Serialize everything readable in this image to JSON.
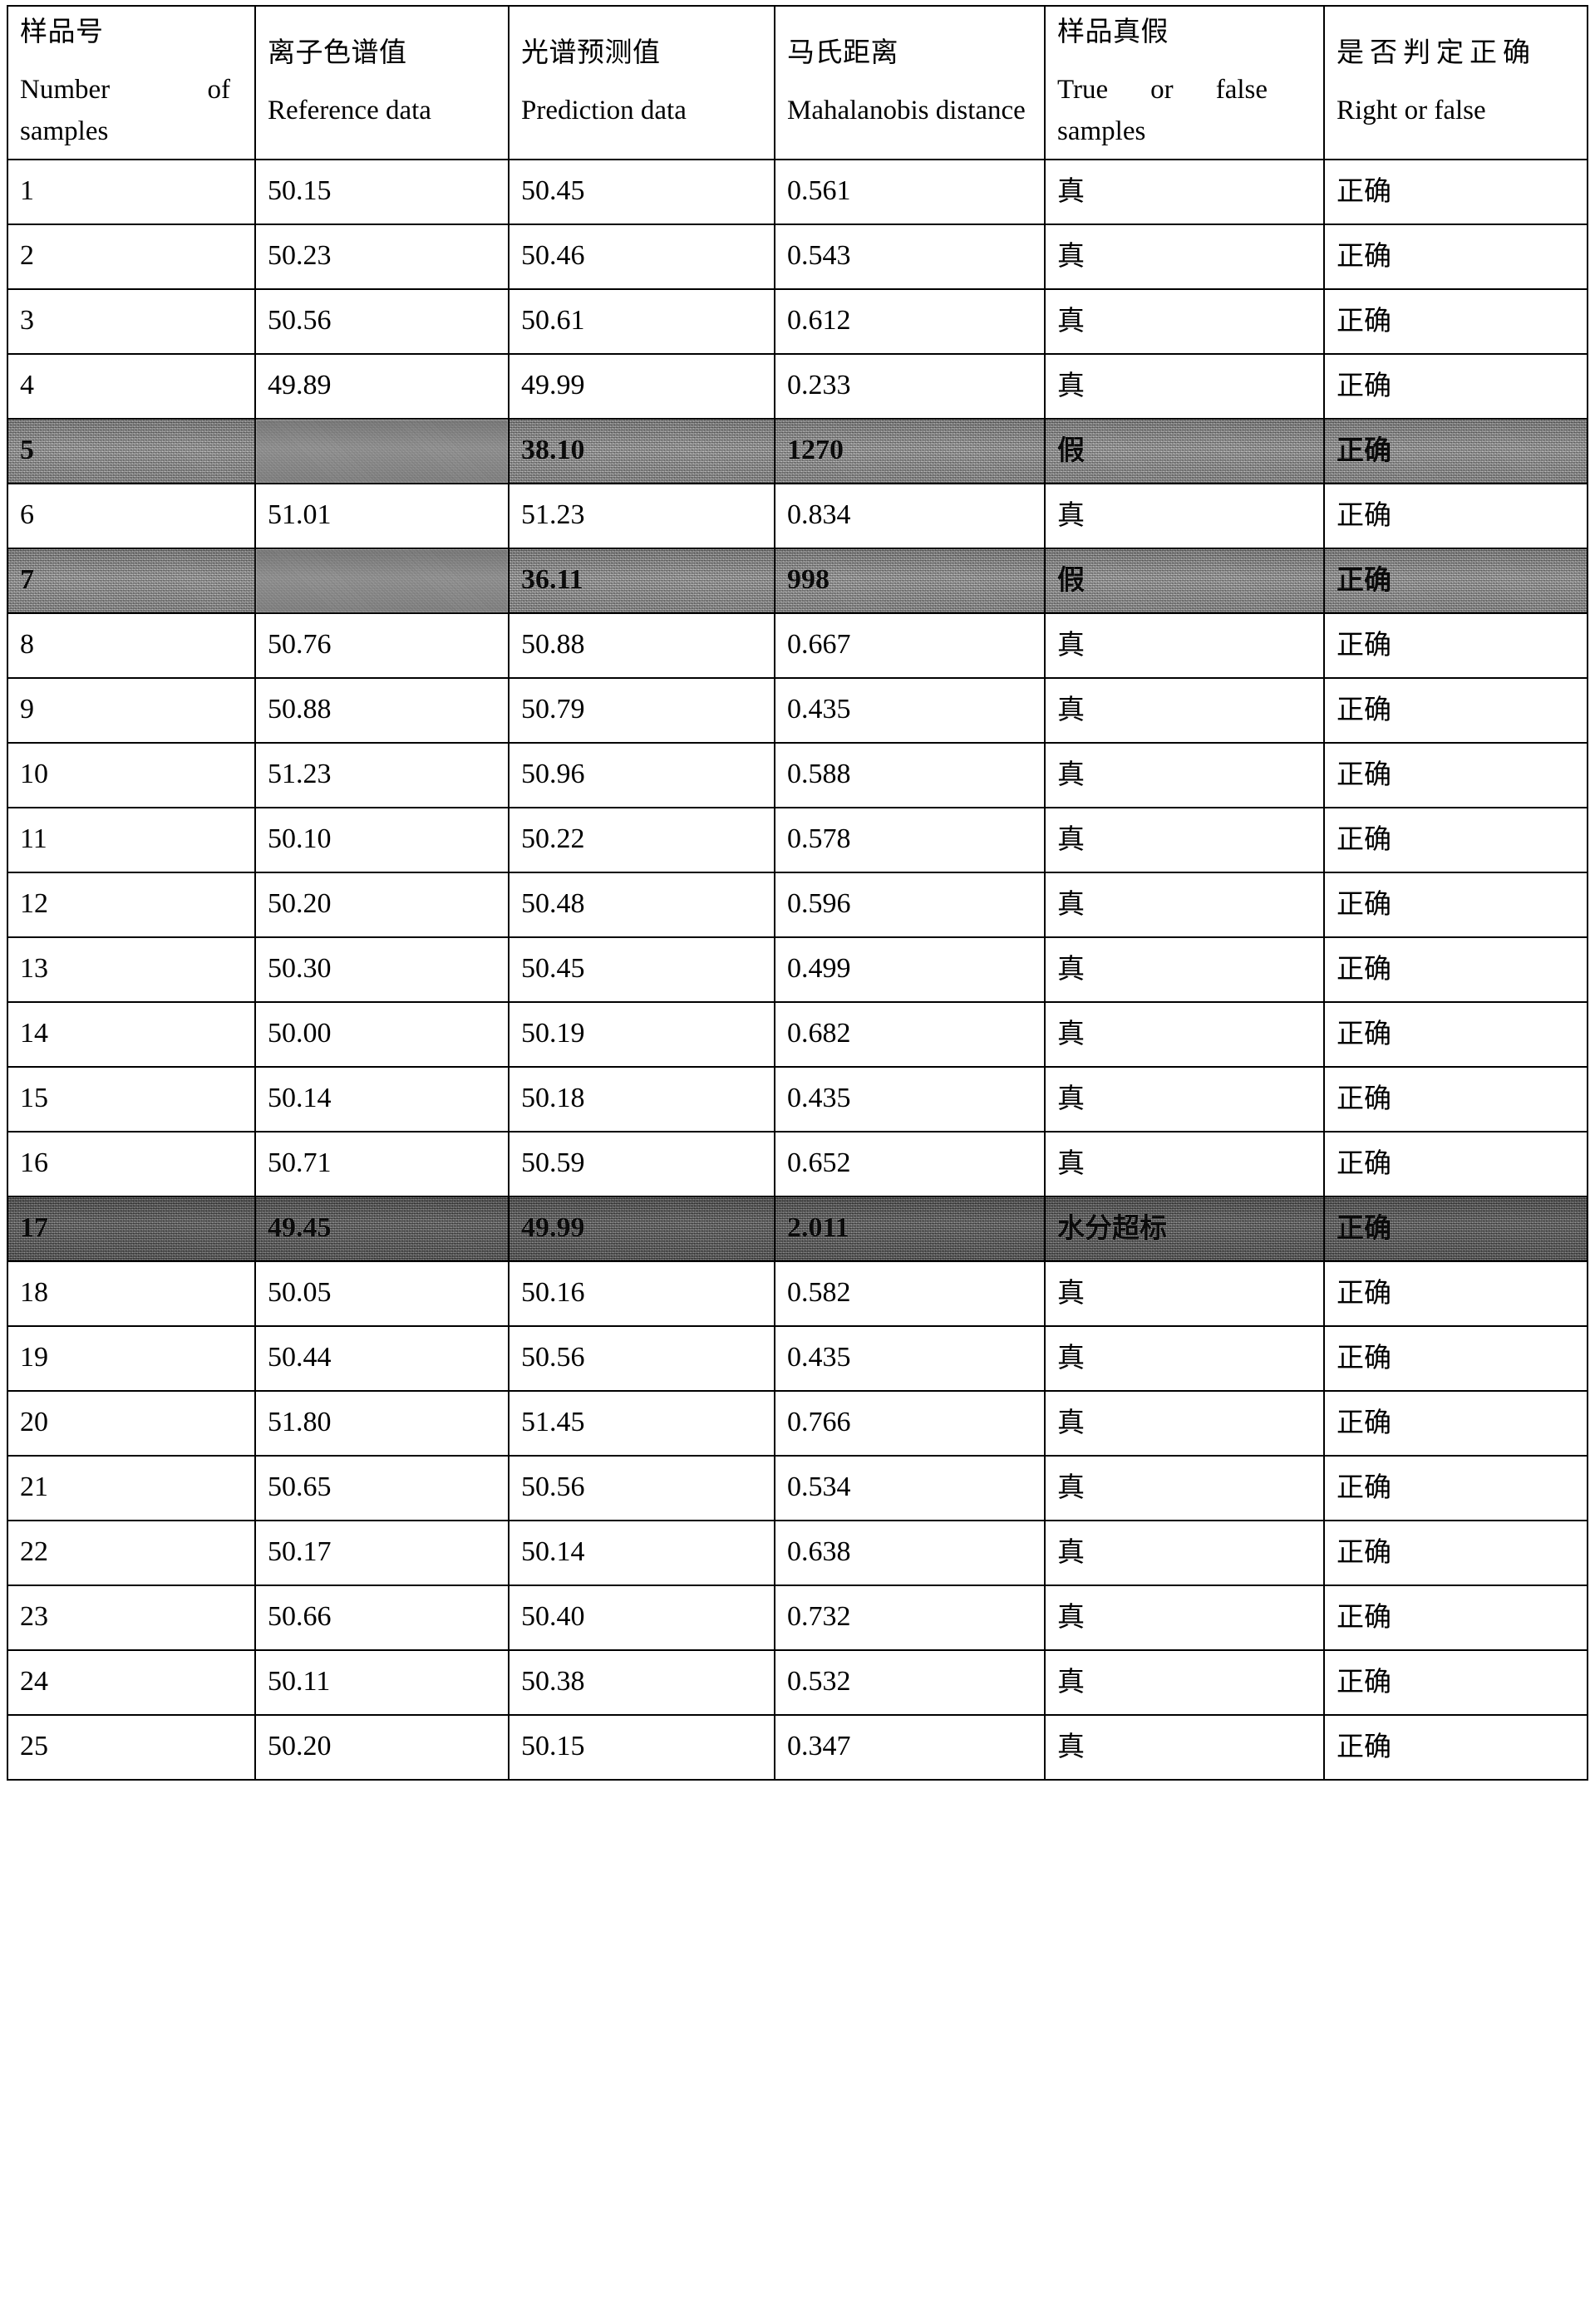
{
  "table": {
    "columns": [
      {
        "cn": "样品号",
        "en": "Number of samples",
        "spaced": false,
        "justify": true
      },
      {
        "cn": "离子色谱值",
        "en": "Reference data",
        "spaced": false,
        "justify": false
      },
      {
        "cn": "光谱预测值",
        "en": "Prediction data",
        "spaced": false,
        "justify": false
      },
      {
        "cn": "马氏距离",
        "en": "Mahalanobis distance",
        "spaced": false,
        "justify": false
      },
      {
        "cn": "样品真假",
        "en": "True or false samples",
        "spaced": false,
        "justify": true
      },
      {
        "cn": "是否判定正确",
        "en": "Right or false",
        "spaced": true,
        "justify": false
      }
    ],
    "rows": [
      {
        "no": "1",
        "reference": "50.15",
        "prediction": "50.45",
        "mahalanobis": "0.561",
        "truefalse": "真",
        "rightfalse": "正确",
        "style": "normal"
      },
      {
        "no": "2",
        "reference": "50.23",
        "prediction": "50.46",
        "mahalanobis": "0.543",
        "truefalse": "真",
        "rightfalse": "正确",
        "style": "normal"
      },
      {
        "no": "3",
        "reference": "50.56",
        "prediction": "50.61",
        "mahalanobis": "0.612",
        "truefalse": "真",
        "rightfalse": "正确",
        "style": "normal"
      },
      {
        "no": "4",
        "reference": "49.89",
        "prediction": "49.99",
        "mahalanobis": "0.233",
        "truefalse": "真",
        "rightfalse": "正确",
        "style": "normal"
      },
      {
        "no": "5",
        "reference": "",
        "prediction": "38.10",
        "mahalanobis": "1270",
        "truefalse": "假",
        "rightfalse": "正确",
        "style": "shaded",
        "illegible": [
          "reference"
        ]
      },
      {
        "no": "6",
        "reference": "51.01",
        "prediction": "51.23",
        "mahalanobis": "0.834",
        "truefalse": "真",
        "rightfalse": "正确",
        "style": "normal"
      },
      {
        "no": "7",
        "reference": "",
        "prediction": "36.11",
        "mahalanobis": "998",
        "truefalse": "假",
        "rightfalse": "正确",
        "style": "shaded",
        "illegible": [
          "reference"
        ]
      },
      {
        "no": "8",
        "reference": "50.76",
        "prediction": "50.88",
        "mahalanobis": "0.667",
        "truefalse": "真",
        "rightfalse": "正确",
        "style": "normal"
      },
      {
        "no": "9",
        "reference": "50.88",
        "prediction": "50.79",
        "mahalanobis": "0.435",
        "truefalse": "真",
        "rightfalse": "正确",
        "style": "normal"
      },
      {
        "no": "10",
        "reference": "51.23",
        "prediction": "50.96",
        "mahalanobis": "0.588",
        "truefalse": "真",
        "rightfalse": "正确",
        "style": "normal"
      },
      {
        "no": "11",
        "reference": "50.10",
        "prediction": "50.22",
        "mahalanobis": "0.578",
        "truefalse": "真",
        "rightfalse": "正确",
        "style": "normal"
      },
      {
        "no": "12",
        "reference": "50.20",
        "prediction": "50.48",
        "mahalanobis": "0.596",
        "truefalse": "真",
        "rightfalse": "正确",
        "style": "normal"
      },
      {
        "no": "13",
        "reference": "50.30",
        "prediction": "50.45",
        "mahalanobis": "0.499",
        "truefalse": "真",
        "rightfalse": "正确",
        "style": "normal"
      },
      {
        "no": "14",
        "reference": "50.00",
        "prediction": "50.19",
        "mahalanobis": "0.682",
        "truefalse": "真",
        "rightfalse": "正确",
        "style": "normal"
      },
      {
        "no": "15",
        "reference": "50.14",
        "prediction": "50.18",
        "mahalanobis": "0.435",
        "truefalse": "真",
        "rightfalse": "正确",
        "style": "normal"
      },
      {
        "no": "16",
        "reference": "50.71",
        "prediction": "50.59",
        "mahalanobis": "0.652",
        "truefalse": "真",
        "rightfalse": "正确",
        "style": "normal"
      },
      {
        "no": "17",
        "reference": "49.45",
        "prediction": "49.99",
        "mahalanobis": "2.011",
        "truefalse": "水分超标",
        "rightfalse": "正确",
        "style": "shaded-dark"
      },
      {
        "no": "18",
        "reference": "50.05",
        "prediction": "50.16",
        "mahalanobis": "0.582",
        "truefalse": "真",
        "rightfalse": "正确",
        "style": "normal"
      },
      {
        "no": "19",
        "reference": "50.44",
        "prediction": "50.56",
        "mahalanobis": "0.435",
        "truefalse": "真",
        "rightfalse": "正确",
        "style": "normal"
      },
      {
        "no": "20",
        "reference": "51.80",
        "prediction": "51.45",
        "mahalanobis": "0.766",
        "truefalse": "真",
        "rightfalse": "正确",
        "style": "normal"
      },
      {
        "no": "21",
        "reference": "50.65",
        "prediction": "50.56",
        "mahalanobis": "0.534",
        "truefalse": "真",
        "rightfalse": "正确",
        "style": "normal"
      },
      {
        "no": "22",
        "reference": "50.17",
        "prediction": "50.14",
        "mahalanobis": "0.638",
        "truefalse": "真",
        "rightfalse": "正确",
        "style": "normal"
      },
      {
        "no": "23",
        "reference": "50.66",
        "prediction": "50.40",
        "mahalanobis": "0.732",
        "truefalse": "真",
        "rightfalse": "正确",
        "style": "normal"
      },
      {
        "no": "24",
        "reference": "50.11",
        "prediction": "50.38",
        "mahalanobis": "0.532",
        "truefalse": "真",
        "rightfalse": "正确",
        "style": "normal"
      },
      {
        "no": "25",
        "reference": "50.20",
        "prediction": "50.15",
        "mahalanobis": "0.347",
        "truefalse": "真",
        "rightfalse": "正确",
        "style": "normal"
      }
    ]
  }
}
